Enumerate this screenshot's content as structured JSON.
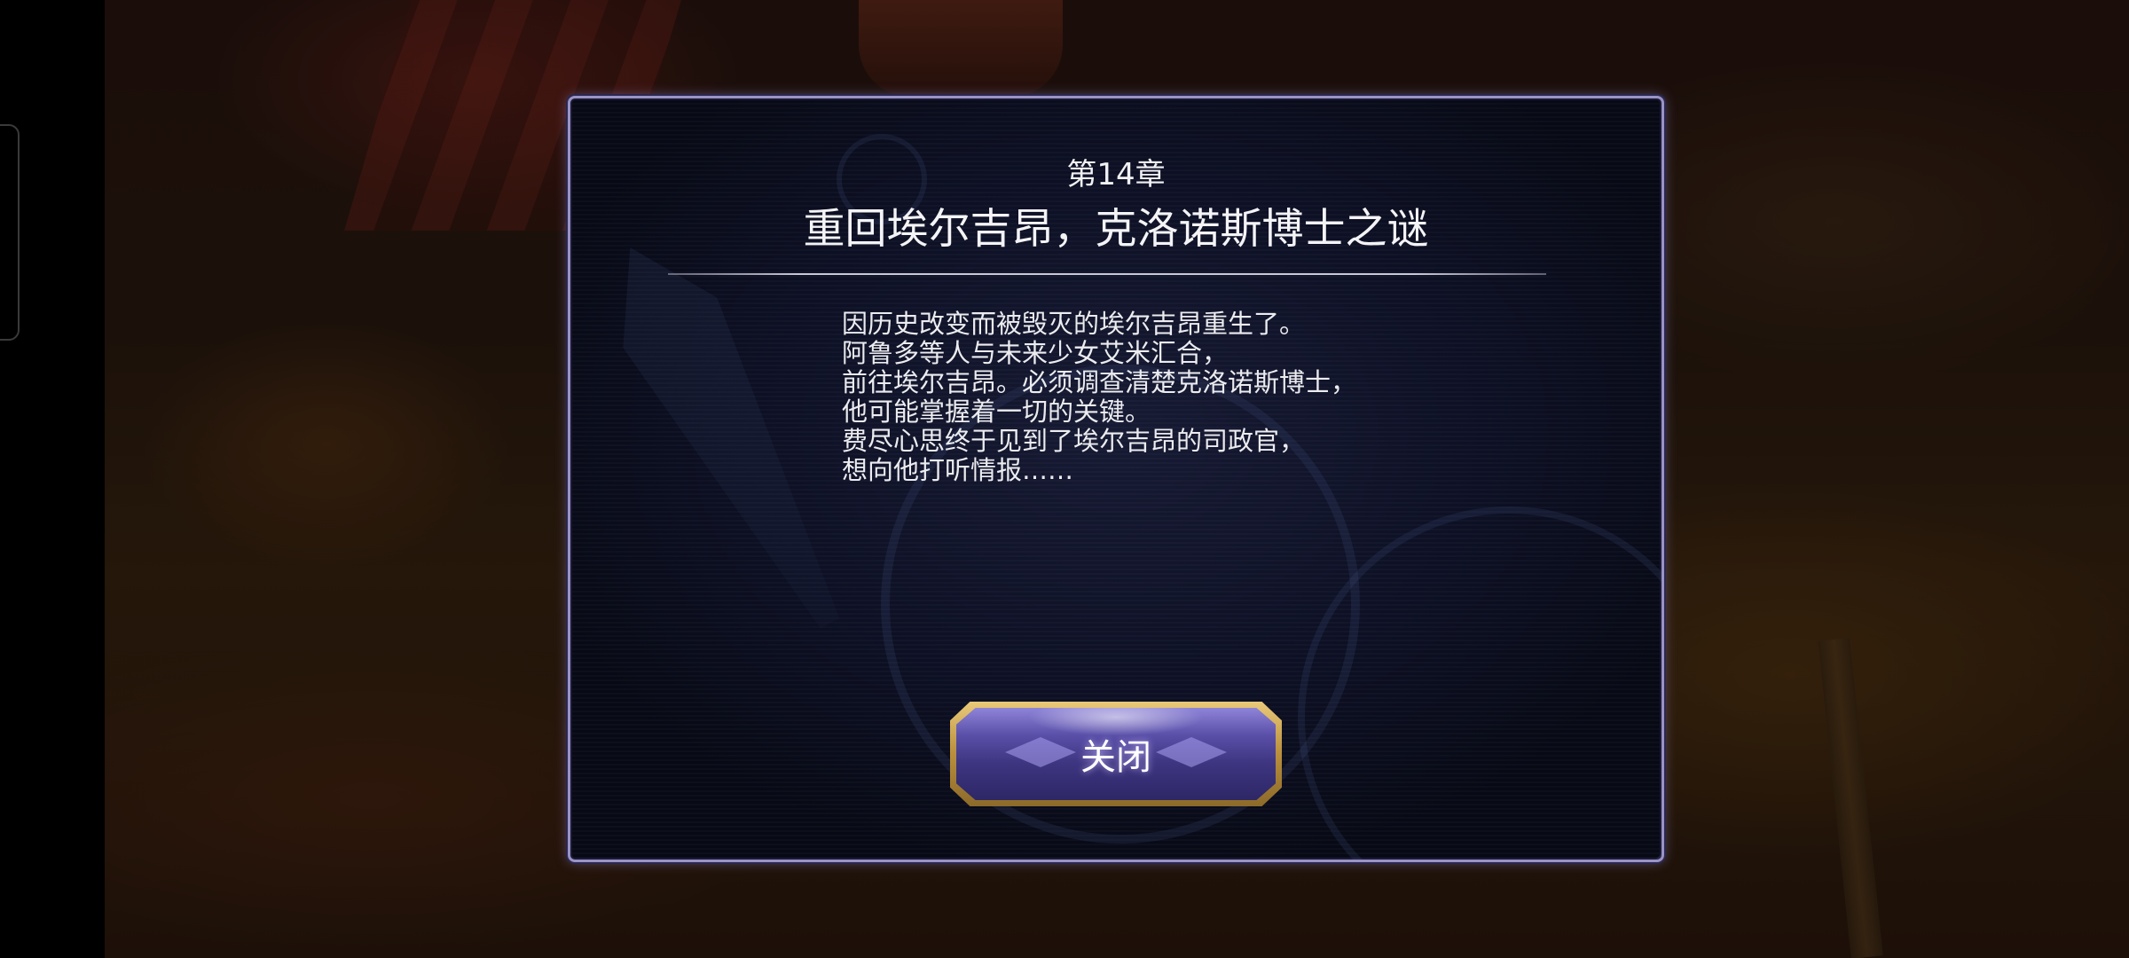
{
  "chapter": {
    "label": "第14章",
    "title": "重回埃尔吉昂，克洛诺斯博士之谜"
  },
  "story": {
    "lines": [
      "因历史改变而被毁灭的埃尔吉昂重生了。",
      "阿鲁多等人与未来少女艾米汇合，",
      "前往埃尔吉昂。必须调查清楚克洛诺斯博士，",
      "他可能掌握着一切的关键。",
      "费尽心思终于见到了埃尔吉昂的司政官，",
      "想向他打听情报……"
    ]
  },
  "buttons": {
    "close_label": "关闭"
  },
  "colors": {
    "dialog_border": "#9a93c4",
    "dialog_bg": "#0d1024",
    "button_gold": "#d4b060",
    "button_purple": "#5a4fa8",
    "text": "#f1f1f4"
  }
}
